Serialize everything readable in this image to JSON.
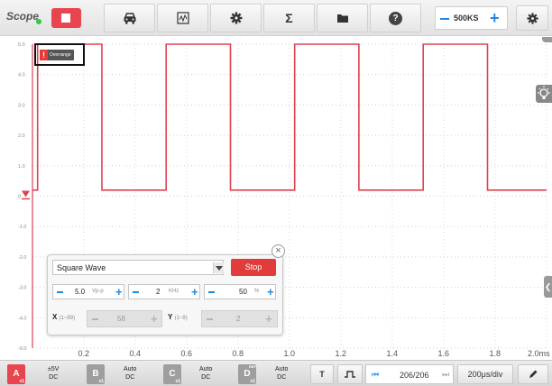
{
  "app": {
    "title": "Scope",
    "status_color": "#2ecc40"
  },
  "toolbar": {
    "stop_icon": "stop-square-icon",
    "tools": [
      "car-icon",
      "waveform-icon",
      "gear-icon",
      "sigma-icon",
      "folder-icon",
      "help-icon"
    ],
    "sigma_label": "Σ",
    "help_label": "?",
    "sample_rate": "500KS",
    "settings_icon": "gear-icon"
  },
  "overrange": {
    "label": "Overrange"
  },
  "colors": {
    "channel_a": "#e8454f",
    "accent": "#1e88e5",
    "trace": "#e04050"
  },
  "chart_data": {
    "type": "line",
    "yticks": [
      "5.0",
      "4.0",
      "3.0",
      "2.0",
      "1.0",
      "0",
      "-1.0",
      "-2.0",
      "-3.0",
      "-4.0",
      "-5.0"
    ],
    "xticks": [
      "0.2",
      "0.4",
      "0.6",
      "0.8",
      "1.0",
      "1.2",
      "1.4",
      "1.6",
      "1.8",
      "2.0ms"
    ],
    "ylim": [
      -5,
      5
    ],
    "xlim": [
      0,
      2.0
    ],
    "x_unit": "ms",
    "grid": true,
    "series": [
      {
        "color": "#e04050",
        "points": [
          [
            0,
            0.2
          ],
          [
            0.02,
            0.2
          ],
          [
            0.02,
            5.0
          ],
          [
            0.27,
            5.0
          ],
          [
            0.27,
            0.2
          ],
          [
            0.52,
            0.2
          ],
          [
            0.52,
            5.0
          ],
          [
            0.77,
            5.0
          ],
          [
            0.77,
            0.2
          ],
          [
            1.02,
            0.2
          ],
          [
            1.02,
            5.0
          ],
          [
            1.27,
            5.0
          ],
          [
            1.27,
            0.2
          ],
          [
            1.52,
            0.2
          ],
          [
            1.52,
            5.0
          ],
          [
            1.77,
            5.0
          ],
          [
            1.77,
            0.2
          ],
          [
            2.0,
            0.2
          ]
        ]
      }
    ]
  },
  "generator": {
    "waveform": "Square Wave",
    "stop_label": "Stop",
    "amplitude": {
      "value": "5.0",
      "unit": "Vp-p"
    },
    "frequency": {
      "value": "2",
      "unit": "KHz"
    },
    "duty": {
      "value": "50",
      "unit": "%"
    },
    "x_label": "X",
    "x_range": "(1~99)",
    "x_value": "58",
    "y_label": "Y",
    "y_range": "(1~9)",
    "y_value": "2",
    "close_label": "×"
  },
  "bottom": {
    "ch_a": {
      "label": "A",
      "sub": "x1",
      "color": "#e8454f",
      "config": [
        "±5V",
        "DC"
      ]
    },
    "ch_b": {
      "label": "B",
      "sub": "x1",
      "color": "#9e9e9e",
      "config": [
        "Auto",
        "DC"
      ]
    },
    "ch_c": {
      "label": "C",
      "sub": "x1",
      "color": "#9e9e9e",
      "config": [
        "Auto",
        "DC"
      ]
    },
    "ch_d": {
      "label": "D",
      "sub": "x1",
      "tag": "REF",
      "color": "#9e9e9e",
      "config": [
        "Auto",
        "DC"
      ]
    },
    "trigger_label": "T",
    "pulse_icon": "pulse-icon",
    "pager": "206/206",
    "timebase": "200μs/div",
    "pen_icon": "pen-icon"
  }
}
